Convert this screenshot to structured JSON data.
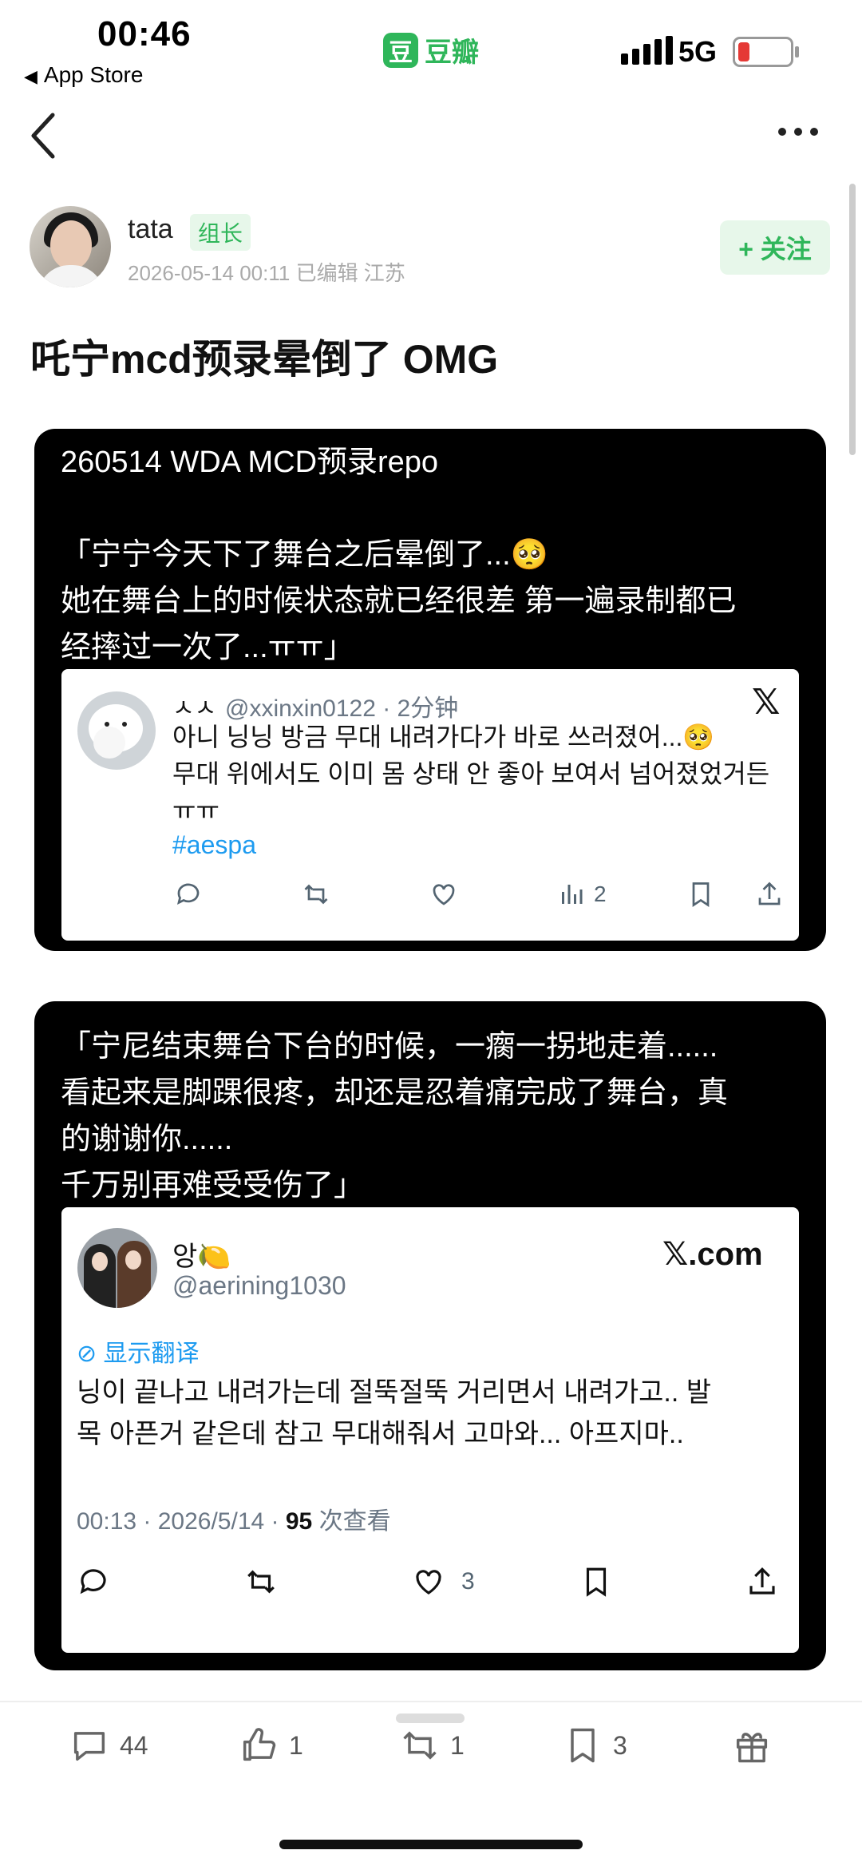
{
  "status_bar": {
    "time": "00:46",
    "back_app": "App Store",
    "app_name": "豆瓣",
    "app_logo": "豆",
    "network": "5G",
    "battery_color": "#e53935"
  },
  "post": {
    "author": {
      "name": "tata",
      "role_badge": "组长",
      "meta": "2026-05-14 00:11  已编辑  江苏"
    },
    "follow_label": "+ 关注",
    "title": "吒宁mcd预录晕倒了 OMG",
    "cards": [
      {
        "text": "260514 WDA MCD预录repo\n\n「宁宁今天下了舞台之后晕倒了...🥺\n她在舞台上的时候状态就已经很差 第一遍录制都已\n经摔过一次了...ㅠㅠ」",
        "tweet": {
          "name": "ㅅㅅ",
          "handle": "@xxinxin0122 · 2分钟",
          "body": "아니 닝닝 방금 무대 내려가다가 바로 쓰러졌어...🥺\n무대 위에서도 이미 몸 상태 안 좋아 보여서 넘어졌었거든\nㅠㅠ",
          "hashtag": "#aespa",
          "views": "2"
        }
      },
      {
        "text": "「宁尼结束舞台下台的时候，一瘸一拐地走着......\n看起来是脚踝很疼，却还是忍着痛完成了舞台，真\n的谢谢你......\n千万别再难受受伤了」",
        "tweet": {
          "name": "앙🍋",
          "handle": "@aerining1030",
          "brand": "𝕏.com",
          "translate": "显示翻译",
          "body": "닝이 끝나고 내려가는데 절뚝절뚝 거리면서 내려가고.. 발\n목 아픈거 같은데 참고 무대해줘서 고마와... 아프지마..",
          "time": "00:13 · 2026/5/14 · ",
          "views_count": "95",
          "views_label": " 次查看",
          "likes": "3"
        }
      }
    ]
  },
  "bottom_bar": {
    "comments": "44",
    "likes": "1",
    "reshares": "1",
    "collects": "3"
  }
}
